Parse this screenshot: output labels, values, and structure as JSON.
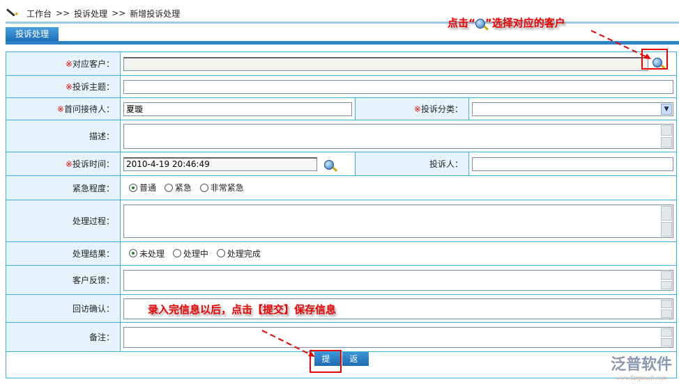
{
  "breadcrumb": [
    "工作台",
    ">>",
    "投诉处理",
    ">>",
    "新增投诉处理"
  ],
  "tab": "投诉处理",
  "required_mark": "※",
  "fields": {
    "customer": "对应客户：",
    "subject": "投诉主题：",
    "receiver": "首问接待人：",
    "receiver_value": "夏璇",
    "category": "投诉分类：",
    "desc": "描述：",
    "time": "投诉时间：",
    "time_value": "2010-4-19 20:46:49",
    "complainant": "投诉人：",
    "urgency": "紧急程度：",
    "process": "处理过程：",
    "result": "处理结果：",
    "feedback": "客户反馈：",
    "revisit": "回访确认：",
    "remark": "备注："
  },
  "urgency_options": [
    "普通",
    "紧急",
    "非常紧急"
  ],
  "result_options": [
    "未处理",
    "处理中",
    "处理完成"
  ],
  "buttons": {
    "submit": "提 交",
    "back": "返 回"
  },
  "annotations": {
    "top_a": "点击“",
    "top_b": "”选择对应的客户",
    "bottom": "录入完信息以后，点击【提交】保存信息"
  },
  "logo": {
    "name": "泛普软件",
    "url": "www.fanpusoft.com"
  }
}
